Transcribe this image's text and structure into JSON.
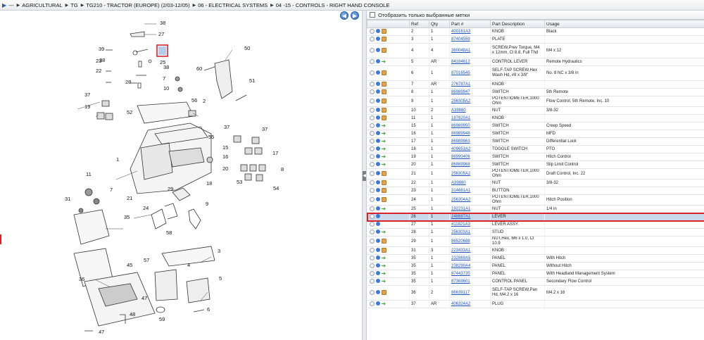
{
  "breadcrumb": {
    "items": [
      "---",
      "AGRICULTURAL",
      "TG",
      "TG210 - TRACTOR (EUROPE) (2/03-12/05)",
      "06 - ELECTRICAL SYSTEMS",
      "04 -15 - CONTROLS - RIGHT HAND CONSOLE"
    ]
  },
  "nav": {
    "prev": "◀",
    "next": "▶"
  },
  "filter": {
    "label": "Отобразить только выбранные метки",
    "checked": false
  },
  "table": {
    "headers": [
      "Ref",
      "Qty",
      "Part #",
      "Part Description",
      "Usage"
    ],
    "rows": [
      {
        "ref": "2",
        "qty": "1",
        "part": "400161A3",
        "desc": "KNOB",
        "usage": "Black",
        "icon": "cart"
      },
      {
        "ref": "3",
        "qty": "1",
        "part": "87404559",
        "desc": "PLATE",
        "usage": "",
        "icon": "cart"
      },
      {
        "ref": "4",
        "qty": "4",
        "part": "360048A1",
        "desc": "SCREW,Prev Torque, M4 x 12mm, Cl 8.8, Full Thd",
        "usage": "M4 x 12",
        "icon": "cart"
      },
      {
        "ref": "5",
        "qty": "AR",
        "part": "84184612",
        "desc": "CONTROL LEVER",
        "usage": "Remote Hydraulics",
        "icon": "arrow"
      },
      {
        "ref": "6",
        "qty": "1",
        "part": "87016545",
        "desc": "SELF-TAP SCREW,Hex Wash Hd, #8 x 3/8\"",
        "usage": "No. 8 NC x 3/8 in",
        "icon": "cart"
      },
      {
        "ref": "7",
        "qty": "AR",
        "part": "276787A1",
        "desc": "KNOB",
        "usage": "",
        "icon": "cart"
      },
      {
        "ref": "8",
        "qty": "1",
        "part": "86989947",
        "desc": "SWITCH",
        "usage": "5th Remote",
        "icon": "cart"
      },
      {
        "ref": "9",
        "qty": "1",
        "part": "256305A2",
        "desc": "POTENTIOMETER,1000 Ohm",
        "usage": "Flow Control, 5th Remote, Inc. 10",
        "icon": "cart"
      },
      {
        "ref": "10",
        "qty": "2",
        "part": "A39880",
        "desc": "NUT",
        "usage": "3/8-32",
        "icon": "cart"
      },
      {
        "ref": "11",
        "qty": "1",
        "part": "187820A1",
        "desc": "KNOB",
        "usage": "",
        "icon": "cart"
      },
      {
        "ref": "15",
        "qty": "1",
        "part": "86989950",
        "desc": "SWITCH",
        "usage": "Creep Speed",
        "icon": "arrow"
      },
      {
        "ref": "16",
        "qty": "1",
        "part": "86989948",
        "desc": "SWITCH",
        "usage": "MFD",
        "icon": "arrow"
      },
      {
        "ref": "17",
        "qty": "1",
        "part": "86989963",
        "desc": "SWITCH",
        "usage": "Differential Lock",
        "icon": "arrow"
      },
      {
        "ref": "18",
        "qty": "1",
        "part": "409653A2",
        "desc": "TOGGLE SWITCH",
        "usage": "PTO",
        "icon": "arrow"
      },
      {
        "ref": "19",
        "qty": "1",
        "part": "86990406",
        "desc": "SWITCH",
        "usage": "Hitch Control",
        "icon": "arrow"
      },
      {
        "ref": "20",
        "qty": "1",
        "part": "86989968",
        "desc": "SWITCH",
        "usage": "Slip Limit Control",
        "icon": "arrow"
      },
      {
        "ref": "21",
        "qty": "1",
        "part": "256305A2",
        "desc": "POTENTIOMETER,1000 Ohm",
        "usage": "Draft Control, Inc. 22",
        "icon": "cart"
      },
      {
        "ref": "22",
        "qty": "1",
        "part": "A39880",
        "desc": "NUT",
        "usage": "3/8-32",
        "icon": "cart"
      },
      {
        "ref": "23",
        "qty": "1",
        "part": "314681A1",
        "desc": "BUTTON",
        "usage": "",
        "icon": "cart"
      },
      {
        "ref": "24",
        "qty": "1",
        "part": "256304A2",
        "desc": "POTENTIOMETER,1000 Ohm",
        "usage": "Hitch Position",
        "icon": "cart"
      },
      {
        "ref": "25",
        "qty": "1",
        "part": "192231A1",
        "desc": "NUT",
        "usage": "1/4 in",
        "icon": "arrow"
      },
      {
        "ref": "26",
        "qty": "1",
        "part": "248887A1",
        "desc": "LEVER",
        "usage": "",
        "icon": "none",
        "selected": true
      },
      {
        "ref": "27",
        "qty": "1",
        "part": "411821A3",
        "desc": "LEVER ASSY.",
        "usage": "",
        "icon": "none"
      },
      {
        "ref": "28",
        "qty": "1",
        "part": "256303A1",
        "desc": "STUD",
        "usage": "",
        "icon": "arrow"
      },
      {
        "ref": "29",
        "qty": "1",
        "part": "86520688",
        "desc": "NUT,Hex, M6 x 1.0, Cl 10.9",
        "usage": "",
        "icon": "cart"
      },
      {
        "ref": "31",
        "qty": "3",
        "part": "223433A1",
        "desc": "KNOB",
        "usage": "",
        "icon": "cart"
      },
      {
        "ref": "35",
        "qty": "1",
        "part": "232869A5",
        "desc": "PANEL",
        "usage": "With Hitch",
        "icon": "arrow"
      },
      {
        "ref": "35",
        "qty": "1",
        "part": "238290A4",
        "desc": "PANEL",
        "usage": "Without Hitch",
        "icon": "arrow"
      },
      {
        "ref": "35",
        "qty": "1",
        "part": "87443735",
        "desc": "PANEL",
        "usage": "With Headland Management System",
        "icon": "arrow"
      },
      {
        "ref": "35",
        "qty": "1",
        "part": "87369601",
        "desc": "CONTROL PANEL",
        "usage": "Secondary Flow Control",
        "icon": "arrow"
      },
      {
        "ref": "36",
        "qty": "2",
        "part": "86639117",
        "desc": "SELF-TAP SCREW,Pan Hd, M4.2 x 16",
        "usage": "M4.2 x 16",
        "icon": "cart"
      },
      {
        "ref": "37",
        "qty": "AR",
        "part": "406324A2",
        "desc": "PLUG",
        "usage": "",
        "icon": "arrow"
      }
    ]
  },
  "diagram": {
    "callouts": [
      "38",
      "27",
      "39",
      "26",
      "50",
      "23",
      "38",
      "25",
      "38",
      "22",
      "60",
      "7",
      "28",
      "10",
      "51",
      "37",
      "56",
      "2",
      "19",
      "52",
      "55",
      "37",
      "37",
      "15",
      "17",
      "1",
      "16",
      "8",
      "20",
      "11",
      "53",
      "54",
      "7",
      "18",
      "29",
      "31",
      "21",
      "9",
      "35",
      "24",
      "58",
      "3",
      "36",
      "57",
      "4",
      "45",
      "5",
      "47",
      "6",
      "48",
      "59",
      "47"
    ]
  }
}
